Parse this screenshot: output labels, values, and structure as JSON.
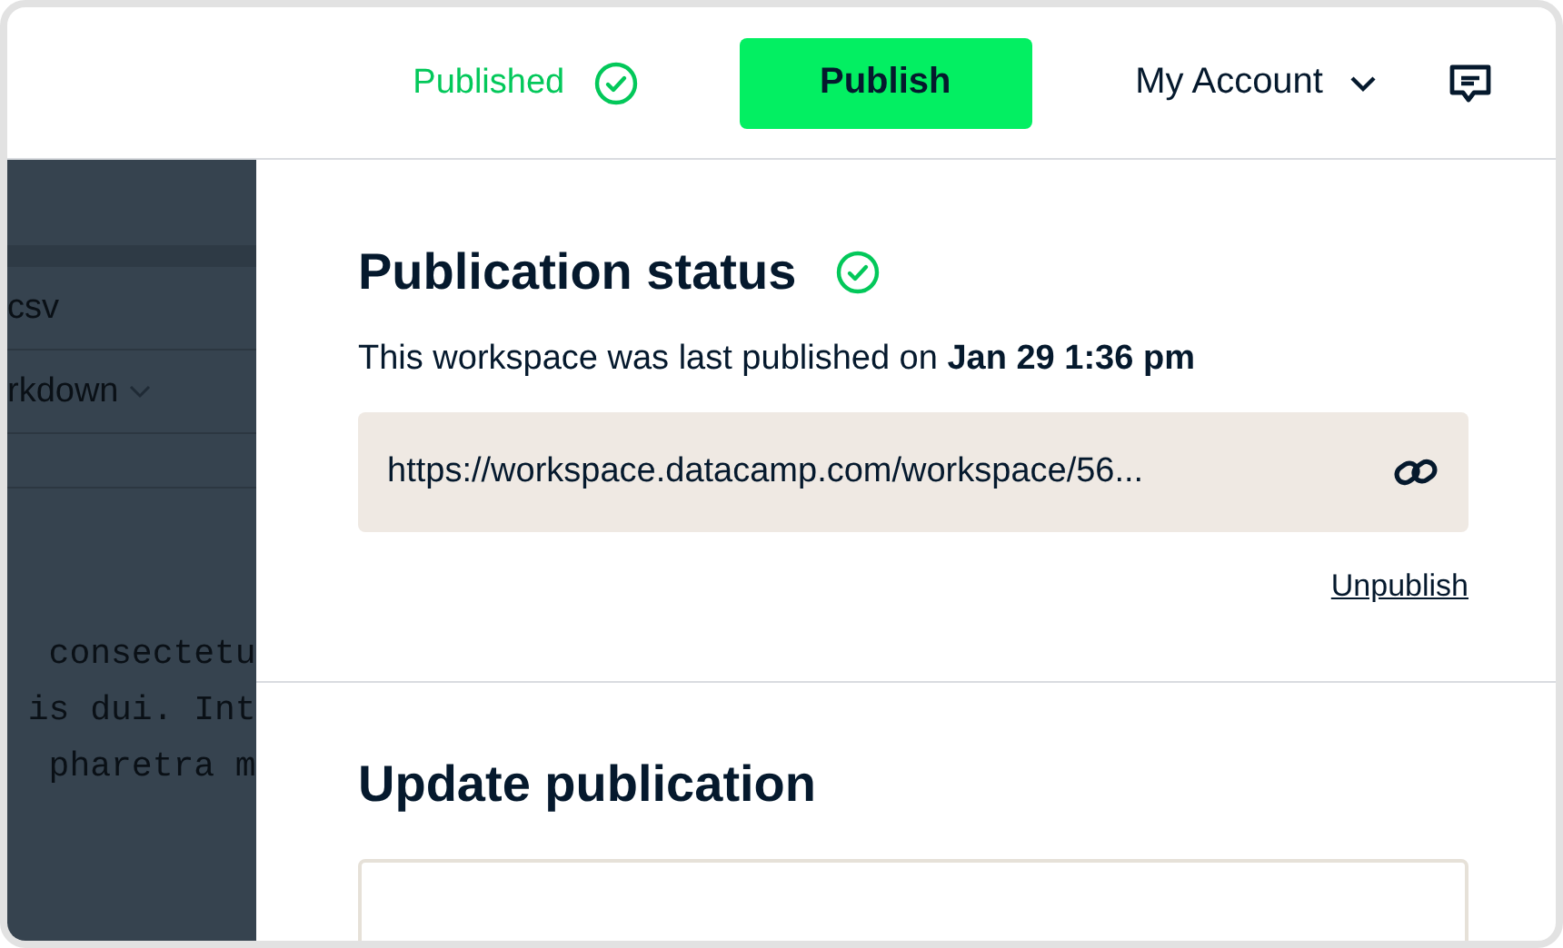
{
  "header": {
    "status": {
      "label": "Published",
      "published": true
    },
    "publish_button": "Publish",
    "account_menu": "My Account"
  },
  "editor_background": {
    "rows": [
      {
        "text": "csv",
        "kind": "plain"
      },
      {
        "text": "rkdown",
        "kind": "dropdown"
      }
    ],
    "code_lines": [
      "  consectetu",
      " is dui. Int",
      "  pharetra m"
    ]
  },
  "publication_status": {
    "title": "Publication status",
    "published": true,
    "description": "This workspace was last published on **Jan 29 1:36 pm**",
    "url": "https://workspace.datacamp.com/workspace/56...",
    "unpublish": "Unpublish"
  },
  "update_publication": {
    "title": "Update publication"
  }
}
